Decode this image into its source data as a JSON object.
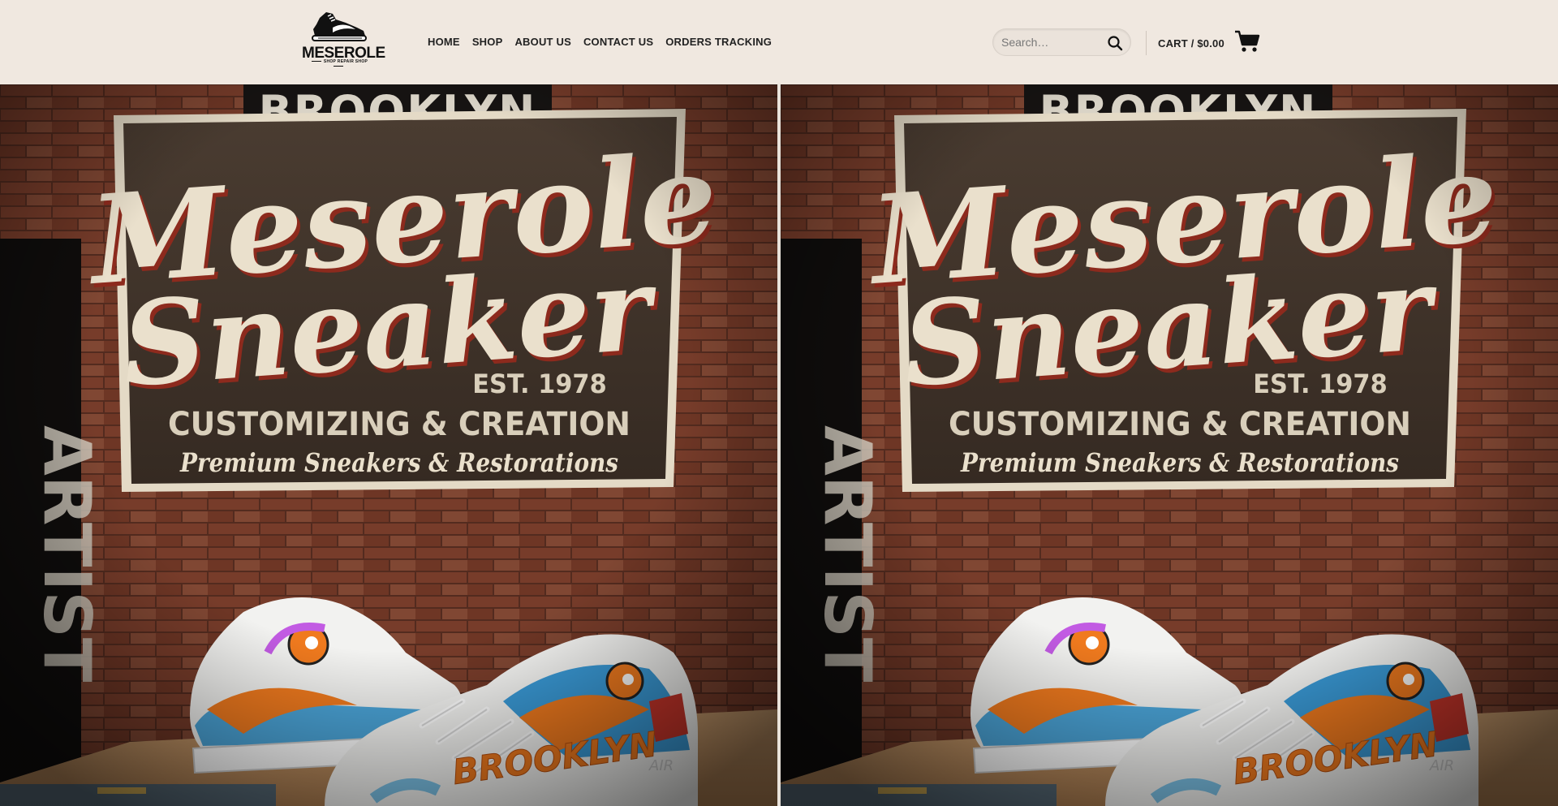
{
  "header": {
    "logo": {
      "name": "MESEROLE",
      "tagline": "SHOP REPAIR SHOP"
    },
    "nav": [
      {
        "label": "HOME"
      },
      {
        "label": "SHOP"
      },
      {
        "label": "ABOUT US"
      },
      {
        "label": "CONTACT US"
      },
      {
        "label": "ORDERS TRACKING"
      }
    ],
    "search": {
      "placeholder": "Search…",
      "icon": "search-icon"
    },
    "cart": {
      "label": "CART / $0.00",
      "icon": "cart-icon"
    }
  },
  "hero": {
    "banner_top": "BROOKLYN",
    "banner_title_1": "Meserole",
    "banner_title_2": "Sneaker",
    "banner_est": "EST. 1978",
    "banner_line": "CUSTOMIZING & CREATION",
    "banner_tagline": "Premium Sneakers & Restorations",
    "side_sign": "ARTIST",
    "shoe_text": "BROOKLYN",
    "shoe_brand": "AIR",
    "colors": {
      "brick": "#7a3e2c",
      "banner": "#3d3128",
      "cream": "#eae0cc",
      "accent_red": "#8d2a1d",
      "shoe_orange": "#f07a1e",
      "shoe_blue": "#3a9bd8"
    }
  }
}
